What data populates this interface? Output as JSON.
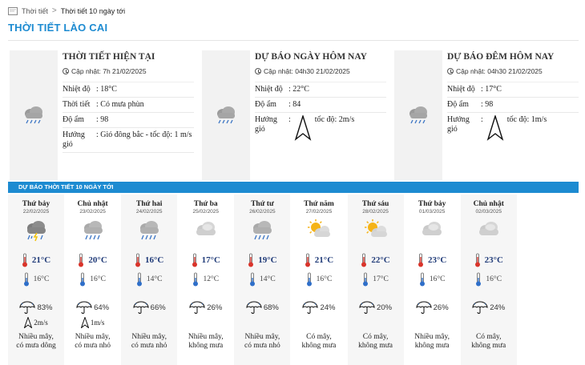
{
  "breadcrumb": {
    "home": "Thời tiết",
    "current": "Thời tiết 10 ngày tới"
  },
  "page_title": "THỜI TIẾT LÀO CAI",
  "cards": [
    {
      "title": "THỜI TIẾT HIỆN TẠI",
      "updated": "Cập nhật: 7h 21/02/2025",
      "rows": [
        {
          "key": "Nhiệt độ",
          "value": ": 18°C"
        },
        {
          "key": "Thời tiết",
          "value": ": Có mưa phùn"
        },
        {
          "key": "Độ ẩm",
          "value": ": 98"
        },
        {
          "key": "Hướng gió",
          "value": ": Gió đông bắc - tốc độ: 1 m/s"
        }
      ]
    },
    {
      "title": "DỰ BÁO NGÀY HÔM NAY",
      "updated": "Cập nhật: 04h30 21/02/2025",
      "rows": [
        {
          "key": "Nhiệt độ",
          "value": ": 22°C"
        },
        {
          "key": "Độ ẩm",
          "value": ": 84"
        },
        {
          "key": "Hướng gió",
          "value": "tốc độ: 2m/s"
        }
      ]
    },
    {
      "title": "DỰ BÁO ĐÊM HÔM NAY",
      "updated": "Cập nhật: 04h30 21/02/2025",
      "rows": [
        {
          "key": "Nhiệt độ",
          "value": ": 17°C"
        },
        {
          "key": "Độ ẩm",
          "value": ": 98"
        },
        {
          "key": "Hướng gió",
          "value": "tốc độ: 1m/s"
        }
      ]
    }
  ],
  "forecast_header": "DỰ BÁO THỜI TIẾT 10 NGÀY TỚI",
  "days": [
    {
      "name": "Thứ bảy",
      "date": "22/02/2025",
      "icon": "thunder-rain-cloud-icon",
      "hi": "21°C",
      "lo": "16°C",
      "rain": "83%",
      "wind": "2m/s",
      "desc1": "Nhiều mây,",
      "desc2": "có mưa dông"
    },
    {
      "name": "Chủ nhật",
      "date": "23/02/2025",
      "icon": "rain-cloud-icon",
      "hi": "20°C",
      "lo": "16°C",
      "rain": "64%",
      "wind": "1m/s",
      "desc1": "Nhiều mây,",
      "desc2": "có mưa nhỏ"
    },
    {
      "name": "Thứ hai",
      "date": "24/02/2025",
      "icon": "rain-cloud-icon",
      "hi": "16°C",
      "lo": "14°C",
      "rain": "66%",
      "wind": "",
      "desc1": "Nhiều mây,",
      "desc2": "có mưa nhỏ"
    },
    {
      "name": "Thứ ba",
      "date": "25/02/2025",
      "icon": "cloudy-icon",
      "hi": "17°C",
      "lo": "12°C",
      "rain": "26%",
      "wind": "",
      "desc1": "Nhiều mây,",
      "desc2": "không mưa"
    },
    {
      "name": "Thứ tư",
      "date": "26/02/2025",
      "icon": "rain-cloud-icon",
      "hi": "19°C",
      "lo": "14°C",
      "rain": "68%",
      "wind": "",
      "desc1": "Nhiều mây,",
      "desc2": "có mưa nhỏ"
    },
    {
      "name": "Thứ năm",
      "date": "27/02/2025",
      "icon": "partly-sunny-icon",
      "hi": "21°C",
      "lo": "16°C",
      "rain": "24%",
      "wind": "",
      "desc1": "Có mây,",
      "desc2": "không mưa"
    },
    {
      "name": "Thứ sáu",
      "date": "28/02/2025",
      "icon": "partly-sunny-icon",
      "hi": "22°C",
      "lo": "17°C",
      "rain": "20%",
      "wind": "",
      "desc1": "Có mây,",
      "desc2": "không mưa"
    },
    {
      "name": "Thứ bảy",
      "date": "01/03/2025",
      "icon": "cloudy-icon",
      "hi": "23°C",
      "lo": "16°C",
      "rain": "26%",
      "wind": "",
      "desc1": "Nhiều mây,",
      "desc2": "không mưa"
    },
    {
      "name": "Chủ nhật",
      "date": "02/03/2025",
      "icon": "cloudy-icon",
      "hi": "23°C",
      "lo": "16°C",
      "rain": "24%",
      "wind": "",
      "desc1": "Có mây,",
      "desc2": "không mưa"
    }
  ],
  "colors": {
    "accent": "#1d8bd1",
    "temp_hi": "#1f3a78"
  }
}
